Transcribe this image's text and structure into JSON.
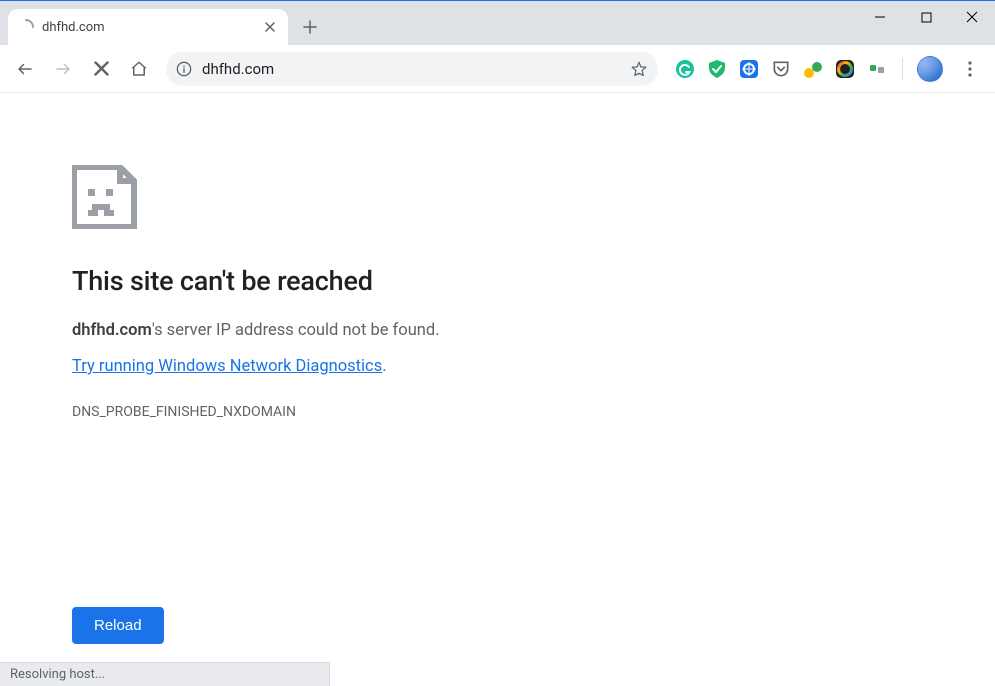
{
  "tab": {
    "title": "dhfhd.com"
  },
  "omnibox": {
    "url": "dhfhd.com"
  },
  "error": {
    "heading": "This site can't be reached",
    "domain": "dhfhd.com",
    "message_suffix": "'s server IP address could not be found.",
    "diagnostics_link": "Try running Windows Network Diagnostics",
    "diagnostics_link_period": ".",
    "code": "DNS_PROBE_FINISHED_NXDOMAIN",
    "reload_label": "Reload"
  },
  "status": {
    "text": "Resolving host..."
  },
  "extensions": [
    "grammarly-icon",
    "adguard-icon",
    "honey-icon",
    "pocket-icon",
    "translate-icon",
    "colorpicker-icon",
    "tampermonkey-icon"
  ],
  "colors": {
    "accent": "#1a73e8",
    "muted": "#5f6368",
    "tabstrip": "#dee1e6"
  }
}
